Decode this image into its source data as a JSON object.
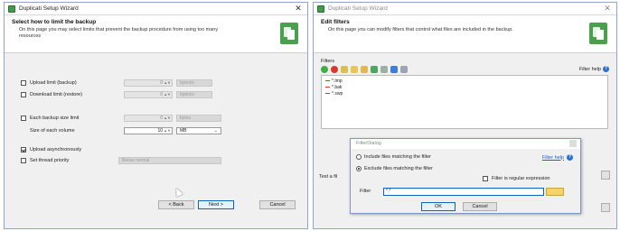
{
  "left": {
    "title": "Duplicati Setup Wizard",
    "header_title": "Select how to limit the backup",
    "header_desc": "On this page you may select limits that prevent the backup procedure from using too many resources",
    "upload_limit": {
      "label": "Upload limit (backup)",
      "value": "0",
      "unit": "bytes/s"
    },
    "download_limit": {
      "label": "Download limit (restore)",
      "value": "0",
      "unit": "bytes/s"
    },
    "each_backup_limit": {
      "label": "Each backup size limit",
      "value": "0",
      "unit": "bytes"
    },
    "volume_size": {
      "label": "Size of each volume",
      "value": "10",
      "unit": "MB"
    },
    "upload_async": {
      "label": "Upload asynchronously",
      "checked": true
    },
    "thread_priority": {
      "label": "Set thread priority",
      "value": "Below normal"
    },
    "buttons": {
      "back": "< Back",
      "next": "Next >",
      "cancel": "Cancel"
    }
  },
  "right": {
    "title": "Duplicati Setup Wizard",
    "header_title": "Edit filters",
    "header_desc": "On this page you can modify filters that control what files are included in the backup.",
    "filters_label": "Filters",
    "filter_help": "Filter help",
    "filters": [
      "*.tmp",
      "*.bak",
      "*.swp"
    ],
    "test_label": "Test a fil",
    "dialog": {
      "title": "FilterDialog",
      "include_label": "Include files matching the filter",
      "exclude_label": "Exclude files matching the filter",
      "help_link": "Filter help",
      "regex_label": "Filter is regular expression",
      "filter_label": "Filter",
      "filter_value": "*.*",
      "ok": "OK",
      "cancel": "Cancel"
    }
  }
}
